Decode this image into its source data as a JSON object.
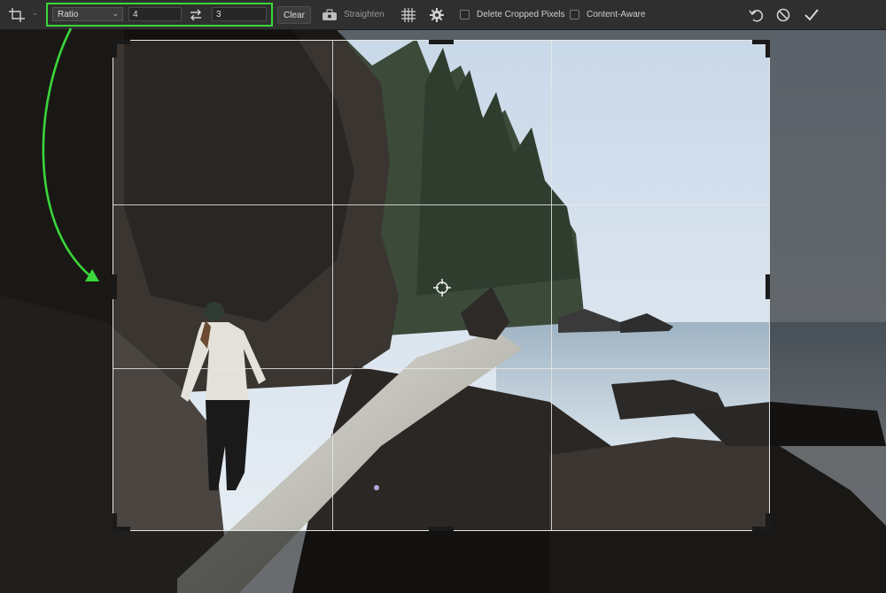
{
  "toolbar": {
    "tool_icon": "crop-icon",
    "ratio_label": "Ratio",
    "width_value": "4",
    "height_value": "3",
    "swap_icon": "swap-arrows-icon",
    "clear_label": "Clear",
    "straighten_label": "Straighten",
    "grid_icon": "grid-overlay-icon",
    "gear_icon": "gear-icon",
    "delete_cropped_label": "Delete Cropped Pixels",
    "delete_cropped_checked": false,
    "content_aware_label": "Content-Aware",
    "content_aware_checked": false,
    "undo_icon": "reset-icon",
    "cancel_icon": "cancel-icon",
    "commit_icon": "checkmark-icon"
  },
  "colors": {
    "highlight": "#3ad63a",
    "toolbar_bg": "#2f2f2f",
    "crop_border": "#e6e6e6"
  }
}
